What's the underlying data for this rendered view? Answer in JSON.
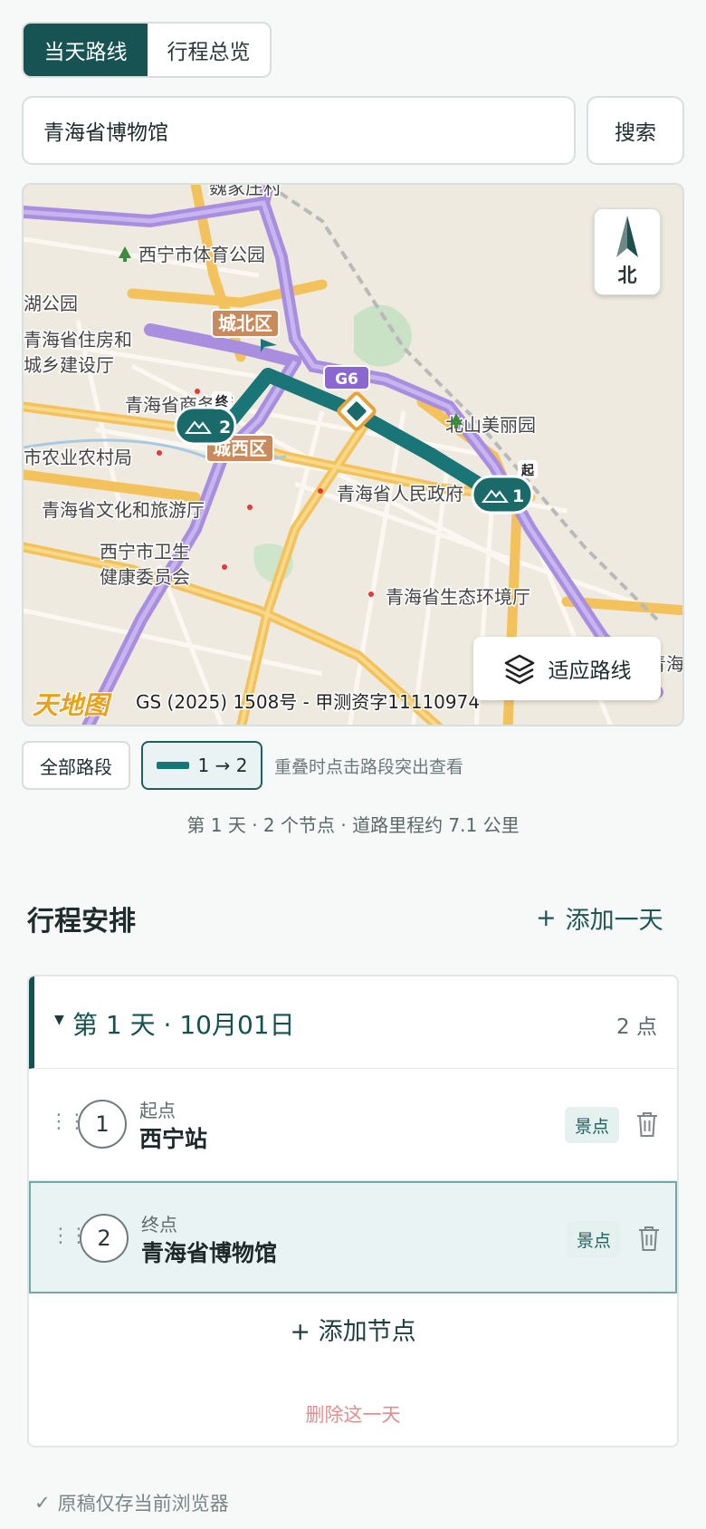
{
  "view_toggle": {
    "today_route": "当天路线",
    "overview": "行程总览"
  },
  "search": {
    "value": "青海省博物馆",
    "button": "搜索"
  },
  "map": {
    "compass_label": "北",
    "fit_route_label": "适应路线",
    "highway_label": "G6",
    "attribution": "GS (2025) 1508号 - 甲测资字11110974",
    "logo_text": "天地图",
    "place_labels": [
      "魏家庄村",
      "西宁市体育公园",
      "城北区",
      "湖公园",
      "青海省住房和",
      "城乡建设厅",
      "北山美丽园",
      "青海省商务厅",
      "城西区",
      "市农业农村局",
      "青海省人民政府",
      "青海省文化和旅游厅",
      "西宁市卫生",
      "健康委员会",
      "青海省生态环境厅",
      "青海省公安"
    ],
    "markers": [
      {
        "number": "1",
        "flag": "起"
      },
      {
        "number": "2",
        "flag": "终"
      }
    ]
  },
  "segments": {
    "all_label": "全部路段",
    "segment_label": "1 → 2",
    "hint": "重叠时点击路段突出查看"
  },
  "summary": "第 1 天 · 2 个节点 · 道路里程约 7.1 公里",
  "itinerary": {
    "title": "行程安排",
    "add_day": "添加一天",
    "days": [
      {
        "title": "第 1 天 · 10月01日",
        "count": "2 点",
        "stops": [
          {
            "index": "1",
            "role": "起点",
            "name": "西宁站",
            "tag": "景点"
          },
          {
            "index": "2",
            "role": "终点",
            "name": "青海省博物馆",
            "tag": "景点"
          }
        ],
        "add_node": "添加节点",
        "delete_day": "删除这一天"
      }
    ]
  },
  "footer_note": "原稿仅存当前浏览器",
  "colors": {
    "primary": "#175353",
    "route": "#1a7676",
    "danger": "#df8f8f",
    "highlight_bg": "#eaf3f3"
  }
}
